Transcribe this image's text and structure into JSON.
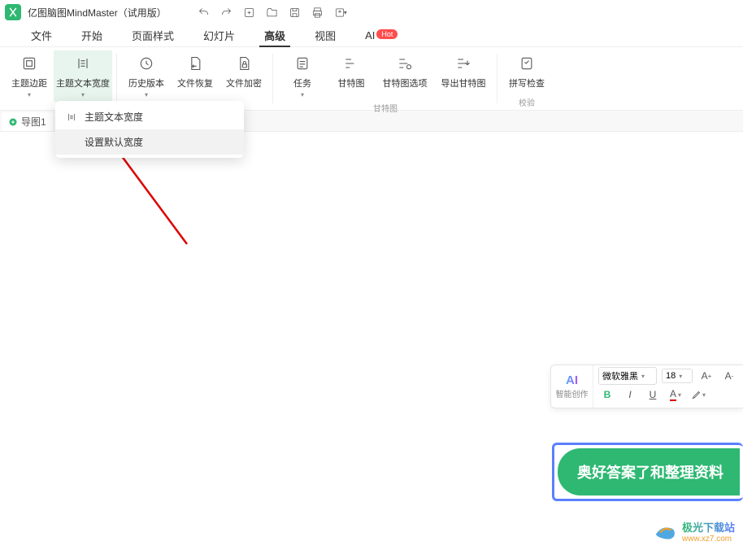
{
  "titlebar": {
    "app_name": "亿图脑图MindMaster",
    "trial_suffix": "（试用版）"
  },
  "menubar": {
    "items": [
      "文件",
      "开始",
      "页面样式",
      "幻灯片",
      "高级",
      "视图"
    ],
    "ai_label": "AI",
    "ai_badge": "Hot",
    "active_index": 4
  },
  "ribbon": {
    "groups": [
      {
        "buttons": [
          {
            "label": "主题边距",
            "icon": "grid",
            "caret": true
          },
          {
            "label": "主题文本宽度",
            "icon": "text-width",
            "caret": true,
            "selected": true
          }
        ]
      },
      {
        "buttons": [
          {
            "label": "历史版本",
            "icon": "history",
            "caret": true
          },
          {
            "label": "文件恢复",
            "icon": "file-restore"
          },
          {
            "label": "文件加密",
            "icon": "file-lock"
          }
        ]
      },
      {
        "label": "甘特图",
        "buttons": [
          {
            "label": "任务",
            "icon": "task",
            "caret": true
          },
          {
            "label": "甘特图",
            "icon": "gantt"
          },
          {
            "label": "甘特图选项",
            "icon": "gantt-options"
          },
          {
            "label": "导出甘特图",
            "icon": "export-gantt"
          }
        ]
      },
      {
        "label": "校验",
        "buttons": [
          {
            "label": "拼写检查",
            "icon": "spellcheck"
          }
        ]
      }
    ]
  },
  "tabs": {
    "items": [
      {
        "label": "导图1"
      }
    ]
  },
  "dropdown": {
    "items": [
      {
        "label": "主题文本宽度",
        "icon": "text-width"
      },
      {
        "label": "设置默认宽度",
        "hover": true
      }
    ]
  },
  "float_toolbar": {
    "ai_label": "AI",
    "ai_sub": "智能创作",
    "font_family": "微软雅黑",
    "font_size": "18",
    "increase": "A⁺",
    "decrease": "A⁻",
    "bold": "B",
    "italic": "I",
    "underline": "U",
    "font_color": "A"
  },
  "topic": {
    "text": "奥好答案了和整理资料"
  },
  "watermark": {
    "title": "极光下载站",
    "url": "www.xz7.com"
  }
}
